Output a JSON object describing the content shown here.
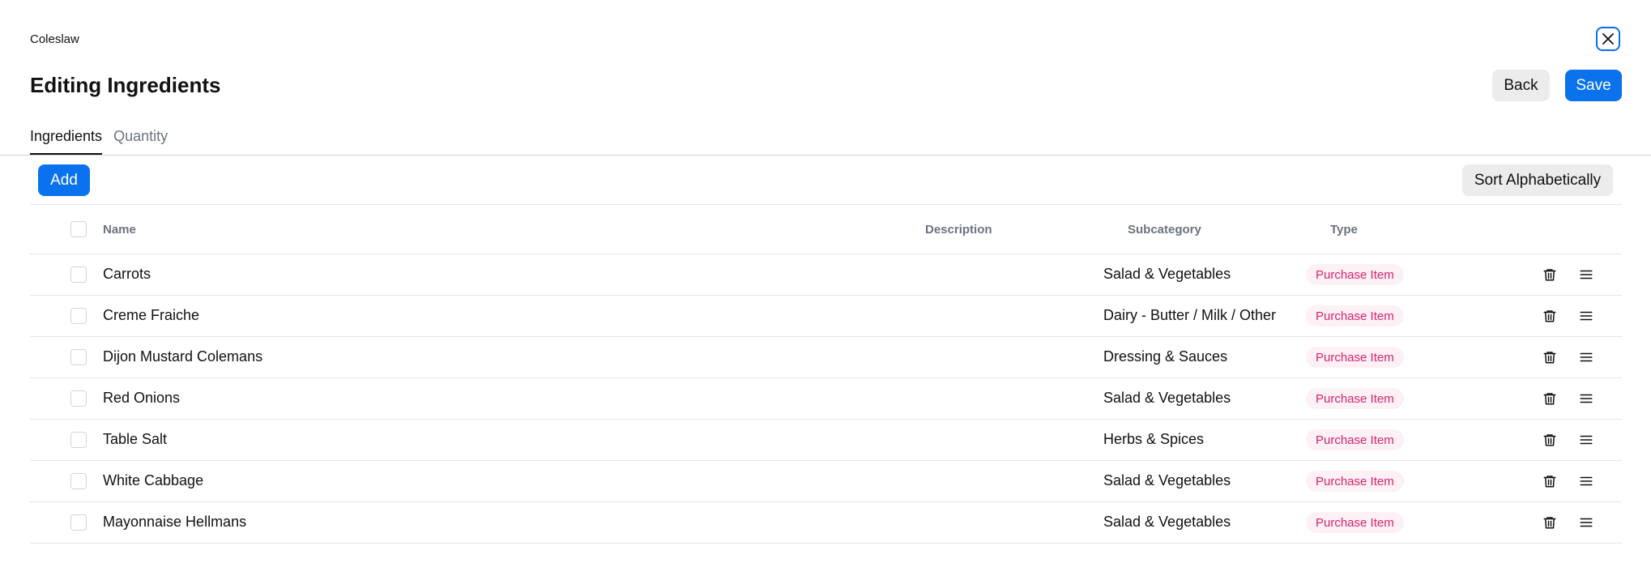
{
  "header": {
    "recipe_name": "Coleslaw",
    "title": "Editing Ingredients",
    "close_icon": "close-icon",
    "back_label": "Back",
    "save_label": "Save"
  },
  "tabs": [
    {
      "label": "Ingredients",
      "active": true
    },
    {
      "label": "Quantity",
      "active": false
    }
  ],
  "toolbar": {
    "add_label": "Add",
    "sort_label": "Sort Alphabetically"
  },
  "table": {
    "columns": {
      "name": "Name",
      "description": "Description",
      "subcategory": "Subcategory",
      "type": "Type"
    },
    "rows": [
      {
        "name": "Carrots",
        "description": "",
        "subcategory": "Salad & Vegetables",
        "type": "Purchase Item"
      },
      {
        "name": "Creme Fraiche",
        "description": "",
        "subcategory": "Dairy - Butter / Milk / Other",
        "type": "Purchase Item"
      },
      {
        "name": "Dijon Mustard Colemans",
        "description": "",
        "subcategory": "Dressing & Sauces",
        "type": "Purchase Item"
      },
      {
        "name": "Red Onions",
        "description": "",
        "subcategory": "Salad & Vegetables",
        "type": "Purchase Item"
      },
      {
        "name": "Table Salt",
        "description": "",
        "subcategory": "Herbs & Spices",
        "type": "Purchase Item"
      },
      {
        "name": "White Cabbage",
        "description": "",
        "subcategory": "Salad & Vegetables",
        "type": "Purchase Item"
      },
      {
        "name": "Mayonnaise Hellmans",
        "description": "",
        "subcategory": "Salad & Vegetables",
        "type": "Purchase Item"
      }
    ],
    "row_icons": {
      "delete": "trash-icon",
      "reorder": "drag-handle-icon"
    }
  },
  "colors": {
    "primary": "#0b72ee",
    "badge_text": "#d6246e",
    "badge_bg": "#fdf1f5",
    "secondary_button": "#ececec"
  }
}
